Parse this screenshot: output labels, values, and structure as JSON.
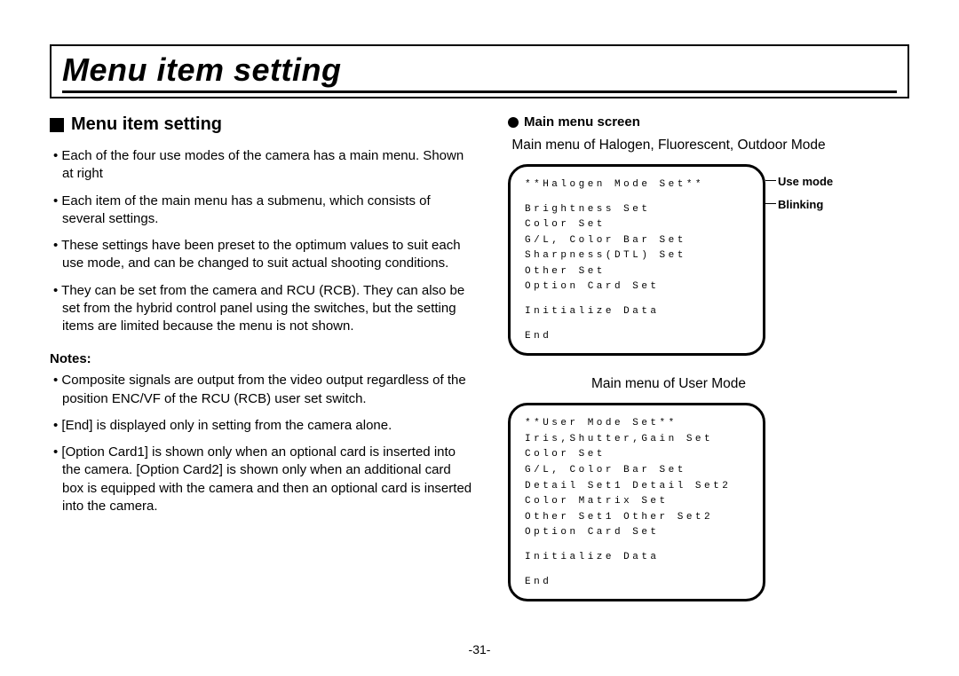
{
  "title": "Menu item setting",
  "section_heading": "Menu item setting",
  "bullets_main": [
    "Each of the four use modes of the camera has a main menu. Shown at right",
    "Each item of the main menu has a submenu, which consists of several settings.",
    "These settings have been preset to the optimum values to suit each use mode, and can be changed to suit actual shooting conditions.",
    "They can be set from the camera and RCU (RCB). They can also be set from the hybrid control panel using the switches, but the setting items are limited because the menu is not shown."
  ],
  "notes_label": "Notes:",
  "bullets_notes": [
    "Composite signals are output from the video output regardless of the position ENC/VF of the RCU (RCB) user set switch.",
    "[End] is displayed only in setting from the camera alone.",
    "[Option Card1] is shown only when an optional card is inserted into the camera. [Option Card2] is shown only when an additional card box is equipped with the camera and then an optional card is inserted into the camera."
  ],
  "right_heading": "Main menu screen",
  "screen1_caption": "Main menu of Halogen, Fluorescent, Outdoor Mode",
  "screen1_lines": {
    "l0": "**Halogen Mode Set**",
    "l1": "Brightness Set",
    "l2": "Color Set",
    "l3": "G/L, Color Bar Set",
    "l4": "Sharpness(DTL) Set",
    "l5": "Other Set",
    "l6": "Option Card Set",
    "l7": "Initialize Data",
    "l8": "End"
  },
  "annotation1": "Use mode",
  "annotation2": "Blinking",
  "screen2_caption": "Main menu of User Mode",
  "screen2_lines": {
    "l0": "**User Mode Set**",
    "l1": "Iris,Shutter,Gain Set",
    "l2": "Color Set",
    "l3": "G/L, Color Bar Set",
    "l4": "Detail Set1 Detail Set2",
    "l5": "Color Matrix Set",
    "l6": "Other Set1   Other Set2",
    "l7": "Option Card Set",
    "l8": "Initialize Data",
    "l9": "End"
  },
  "page_number": "-31-"
}
